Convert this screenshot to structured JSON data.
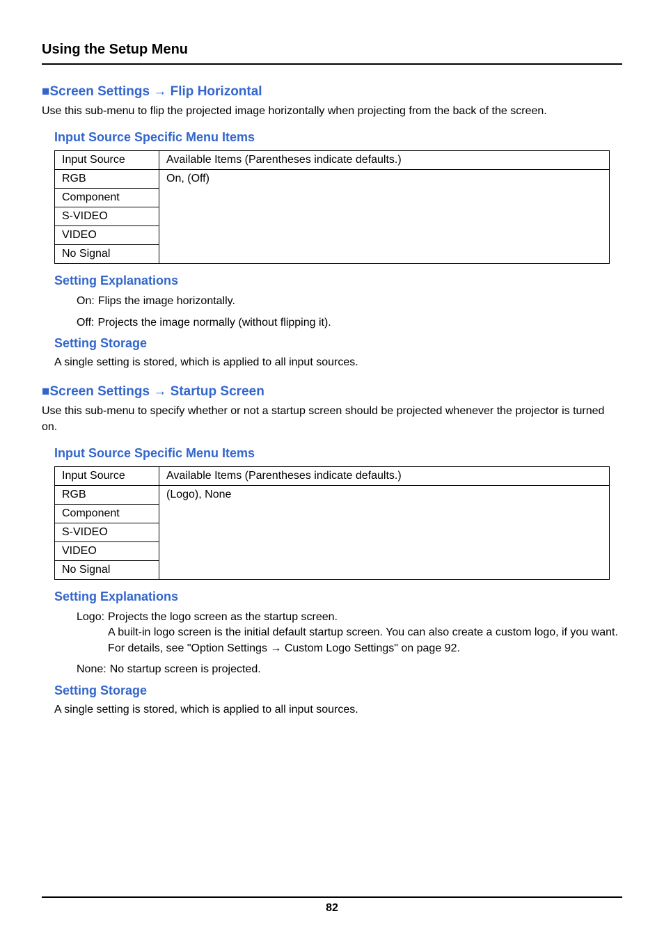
{
  "header": {
    "title": "Using the Setup Menu"
  },
  "section1": {
    "heading_prefix": "■",
    "heading": "Screen Settings → Flip Horizontal",
    "intro": "Use this sub-menu to flip the projected image horizontally when projecting from the back of the screen.",
    "table_heading": "Input Source Specific Menu Items",
    "table": {
      "headers": [
        "Input Source",
        "Available Items (Parentheses indicate defaults.)"
      ],
      "rows": [
        {
          "source": "RGB",
          "items": "On, (Off)"
        },
        {
          "source": "Component",
          "items": ""
        },
        {
          "source": "S-VIDEO",
          "items": ""
        },
        {
          "source": "VIDEO",
          "items": ""
        },
        {
          "source": "No Signal",
          "items": ""
        }
      ]
    },
    "explanations_heading": "Setting Explanations",
    "explanations": [
      {
        "label": "On:",
        "text": "Flips the image horizontally."
      },
      {
        "label": "Off:",
        "text": "Projects the image normally (without flipping it)."
      }
    ],
    "storage_heading": "Setting Storage",
    "storage_text": "A single setting is stored, which is applied to all input sources."
  },
  "section2": {
    "heading_prefix": "■",
    "heading": "Screen Settings → Startup Screen",
    "intro": "Use this sub-menu to specify whether or not a startup screen should be projected whenever the projector is turned on.",
    "table_heading": "Input Source Specific Menu Items",
    "table": {
      "headers": [
        "Input Source",
        "Available Items (Parentheses indicate defaults.)"
      ],
      "rows": [
        {
          "source": "RGB",
          "items": "(Logo), None"
        },
        {
          "source": "Component",
          "items": ""
        },
        {
          "source": "S-VIDEO",
          "items": ""
        },
        {
          "source": "VIDEO",
          "items": ""
        },
        {
          "source": "No Signal",
          "items": ""
        }
      ]
    },
    "explanations_heading": "Setting Explanations",
    "explanations": [
      {
        "label": "Logo:",
        "text": "Projects the logo screen as the startup screen.\nA built-in logo screen is the initial default startup screen. You can also create a custom logo, if you want. For details, see \"Option Settings → Custom Logo Settings\" on page 92."
      },
      {
        "label": "None:",
        "text": "No startup screen is projected."
      }
    ],
    "storage_heading": "Setting Storage",
    "storage_text": "A single setting is stored, which is applied to all input sources."
  },
  "footer": {
    "page_number": "82"
  }
}
